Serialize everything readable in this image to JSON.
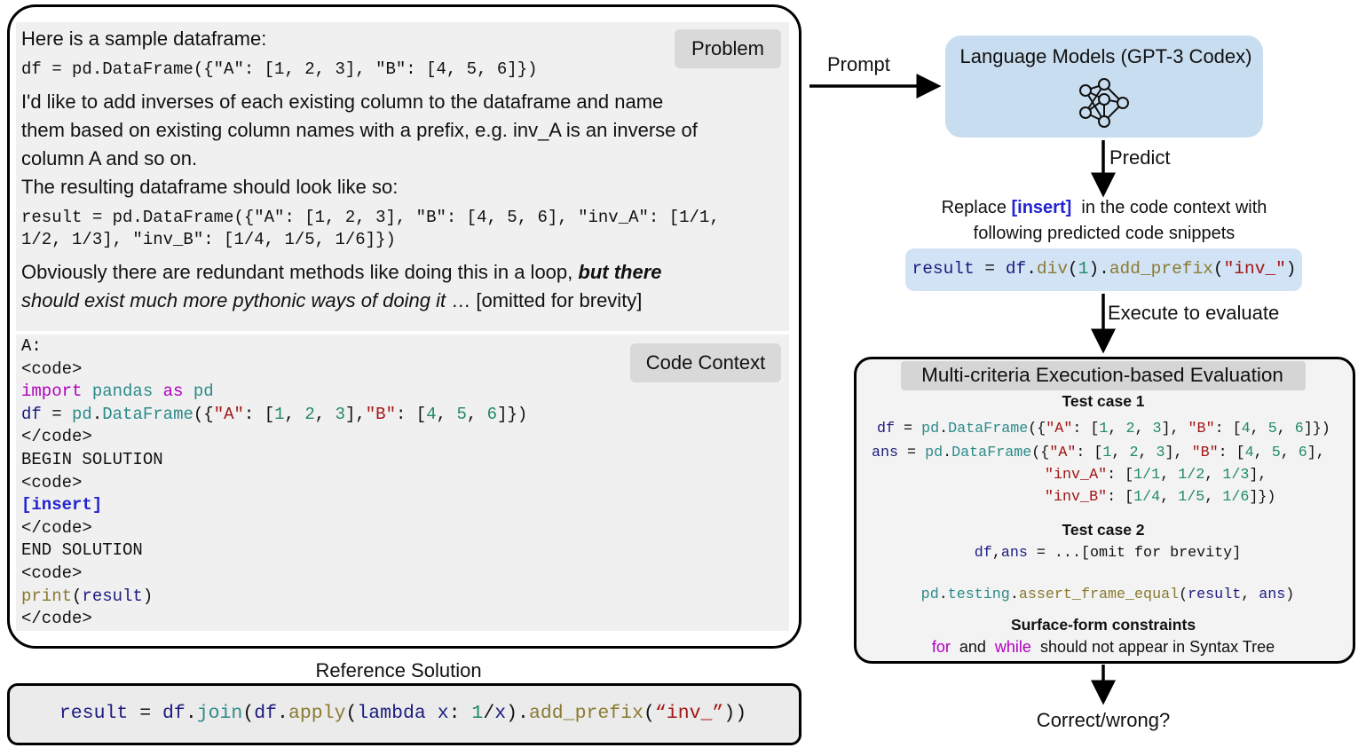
{
  "problem": {
    "label": "Problem",
    "intro": "Here is a sample dataframe:",
    "code1": [
      [
        "df = pd.DataFrame({\"A\": [1, 2, 3], \"B\": [4, 5, 6]})",
        "p"
      ]
    ],
    "text_lines": [
      "I'd like to add inverses of each existing column to the dataframe and name",
      "them based on existing column names with a prefix, e.g. inv_A is an inverse of",
      "column A and so on.",
      "The resulting dataframe should look like so:"
    ],
    "code2": [
      [
        [
          "result = pd.DataFrame({\"A\": [1, 2, 3], \"B\": [4, 5, 6], \"inv_A\": [1/1,",
          "p"
        ]
      ],
      [
        [
          "1/2, 1/3], \"inv_B\": [1/4, 1/5, 1/6]})",
          "p"
        ]
      ]
    ],
    "closing": [
      [
        [
          "Obviously there are redundant methods like doing this in a loop, ",
          "p"
        ],
        [
          "but there",
          "b"
        ]
      ],
      [
        [
          "should exist much more pythonic ways of doing it",
          "it"
        ],
        [
          " … [omitted for brevity]",
          "p"
        ]
      ]
    ]
  },
  "code_context": {
    "label": "Code Context",
    "lines": [
      [
        [
          "A:",
          "p"
        ]
      ],
      [
        [
          "<code>",
          "p"
        ]
      ],
      [
        [
          "import",
          "k"
        ],
        [
          " ",
          "p"
        ],
        [
          "pandas",
          "m"
        ],
        [
          " ",
          "p"
        ],
        [
          "as",
          "k"
        ],
        [
          " ",
          "p"
        ],
        [
          "pd",
          "m"
        ]
      ],
      [
        [
          "df",
          "v"
        ],
        [
          " = ",
          "p"
        ],
        [
          "pd",
          "m"
        ],
        [
          ".",
          "p"
        ],
        [
          "DataFrame",
          "m"
        ],
        [
          "({",
          "p"
        ],
        [
          "\"A\"",
          "s"
        ],
        [
          ": [",
          "p"
        ],
        [
          "1",
          "n"
        ],
        [
          ", ",
          "p"
        ],
        [
          "2",
          "n"
        ],
        [
          ", ",
          "p"
        ],
        [
          "3",
          "n"
        ],
        [
          "],",
          "p"
        ],
        [
          "\"B\"",
          "s"
        ],
        [
          ": [",
          "p"
        ],
        [
          "4",
          "n"
        ],
        [
          ", ",
          "p"
        ],
        [
          "5",
          "n"
        ],
        [
          ", ",
          "p"
        ],
        [
          "6",
          "n"
        ],
        [
          "]})",
          "p"
        ]
      ],
      [
        [
          "</code>",
          "p"
        ]
      ],
      [
        [
          "BEGIN SOLUTION",
          "p"
        ]
      ],
      [
        [
          "<code>",
          "p"
        ]
      ],
      [
        [
          "[insert]",
          "i"
        ]
      ],
      [
        [
          "</code>",
          "p"
        ]
      ],
      [
        [
          "END SOLUTION",
          "p"
        ]
      ],
      [
        [
          "<code>",
          "p"
        ]
      ],
      [
        [
          "print",
          "f"
        ],
        [
          "(",
          "p"
        ],
        [
          "result",
          "v"
        ],
        [
          ")",
          "p"
        ]
      ],
      [
        [
          "</code>",
          "p"
        ]
      ]
    ]
  },
  "reference": {
    "title": "Reference Solution",
    "code": [
      [
        "result",
        "v"
      ],
      [
        " = ",
        "p"
      ],
      [
        "df",
        "v"
      ],
      [
        ".",
        "p"
      ],
      [
        "join",
        "m"
      ],
      [
        "(",
        "p"
      ],
      [
        "df",
        "v"
      ],
      [
        ".",
        "p"
      ],
      [
        "apply",
        "f"
      ],
      [
        "(",
        "p"
      ],
      [
        "lambda",
        "v"
      ],
      [
        " ",
        "p"
      ],
      [
        "x",
        "v"
      ],
      [
        ": ",
        "p"
      ],
      [
        "1",
        "n"
      ],
      [
        "/",
        "p"
      ],
      [
        "x",
        "v"
      ],
      [
        ").",
        "p"
      ],
      [
        "add_prefix",
        "f"
      ],
      [
        "(",
        "p"
      ],
      [
        "“inv_”",
        "s"
      ],
      [
        "))",
        "p"
      ]
    ]
  },
  "flow": {
    "prompt": "Prompt",
    "model_title": "Language Models (GPT-3 Codex)",
    "model_icon": "neural-network-icon",
    "predict": "Predict",
    "replace_line1": [
      [
        "Replace ",
        "p"
      ],
      [
        "[insert]",
        "i"
      ],
      [
        "  in the code context with",
        "p"
      ]
    ],
    "replace_line2": "following predicted code snippets",
    "predicted_code": [
      [
        "result",
        "v"
      ],
      [
        " = ",
        "p"
      ],
      [
        "df",
        "v"
      ],
      [
        ".",
        "p"
      ],
      [
        "div",
        "f"
      ],
      [
        "(",
        "p"
      ],
      [
        "1",
        "n"
      ],
      [
        ").",
        "p"
      ],
      [
        "add_prefix",
        "f"
      ],
      [
        "(",
        "p"
      ],
      [
        "\"inv_\"",
        "s"
      ],
      [
        ")",
        "p"
      ]
    ],
    "execute": "Execute to evaluate",
    "result": "Correct/wrong?"
  },
  "evaluation": {
    "title": "Multi-criteria Execution-based Evaluation",
    "test1_title": "Test case 1",
    "test1_lines": [
      [
        [
          "df",
          "v"
        ],
        [
          " = ",
          "p"
        ],
        [
          "pd",
          "m"
        ],
        [
          ".",
          "p"
        ],
        [
          "DataFrame",
          "m"
        ],
        [
          "({",
          "p"
        ],
        [
          "\"A\"",
          "s"
        ],
        [
          ": [",
          "p"
        ],
        [
          "1",
          "n"
        ],
        [
          ", ",
          "p"
        ],
        [
          "2",
          "n"
        ],
        [
          ", ",
          "p"
        ],
        [
          "3",
          "n"
        ],
        [
          "], ",
          "p"
        ],
        [
          "\"B\"",
          "s"
        ],
        [
          ": [",
          "p"
        ],
        [
          "4",
          "n"
        ],
        [
          ", ",
          "p"
        ],
        [
          "5",
          "n"
        ],
        [
          ", ",
          "p"
        ],
        [
          "6",
          "n"
        ],
        [
          "]})",
          "p"
        ]
      ],
      [
        [
          "ans",
          "v"
        ],
        [
          " = ",
          "p"
        ],
        [
          "pd",
          "m"
        ],
        [
          ".",
          "p"
        ],
        [
          "DataFrame",
          "m"
        ],
        [
          "({",
          "p"
        ],
        [
          "\"A\"",
          "s"
        ],
        [
          ": [",
          "p"
        ],
        [
          "1",
          "n"
        ],
        [
          ", ",
          "p"
        ],
        [
          "2",
          "n"
        ],
        [
          ", ",
          "p"
        ],
        [
          "3",
          "n"
        ],
        [
          "], ",
          "p"
        ],
        [
          "\"B\"",
          "s"
        ],
        [
          ": [",
          "p"
        ],
        [
          "4",
          "n"
        ],
        [
          ", ",
          "p"
        ],
        [
          "5",
          "n"
        ],
        [
          ", ",
          "p"
        ],
        [
          "6",
          "n"
        ],
        [
          "],",
          "p"
        ]
      ],
      [
        [
          "\"inv_A\"",
          "s"
        ],
        [
          ": [",
          "p"
        ],
        [
          "1/1",
          "n"
        ],
        [
          ", ",
          "p"
        ],
        [
          "1/2",
          "n"
        ],
        [
          ", ",
          "p"
        ],
        [
          "1/3",
          "n"
        ],
        [
          "],",
          "p"
        ]
      ],
      [
        [
          "\"inv_B\"",
          "s"
        ],
        [
          ": [",
          "p"
        ],
        [
          "1/4",
          "n"
        ],
        [
          ", ",
          "p"
        ],
        [
          "1/5",
          "n"
        ],
        [
          ", ",
          "p"
        ],
        [
          "1/6",
          "n"
        ],
        [
          "]})",
          "p"
        ]
      ]
    ],
    "test2_title": "Test case 2",
    "test2_line": [
      [
        "df",
        "v"
      ],
      [
        ",",
        "p"
      ],
      [
        "ans",
        "v"
      ],
      [
        " = ...[omit for brevity]",
        "p"
      ]
    ],
    "assert_line": [
      [
        "pd",
        "m"
      ],
      [
        ".",
        "p"
      ],
      [
        "testing",
        "m"
      ],
      [
        ".",
        "p"
      ],
      [
        "assert_frame_equal",
        "f"
      ],
      [
        "(",
        "p"
      ],
      [
        "result",
        "v"
      ],
      [
        ", ",
        "p"
      ],
      [
        "ans",
        "v"
      ],
      [
        ")",
        "p"
      ]
    ],
    "constraints_title": "Surface-form constraints",
    "constraints_line": [
      [
        "for",
        "k"
      ],
      [
        "  and  ",
        "p"
      ],
      [
        "while",
        "k"
      ],
      [
        "  should not appear in Syntax Tree",
        "p"
      ]
    ]
  }
}
